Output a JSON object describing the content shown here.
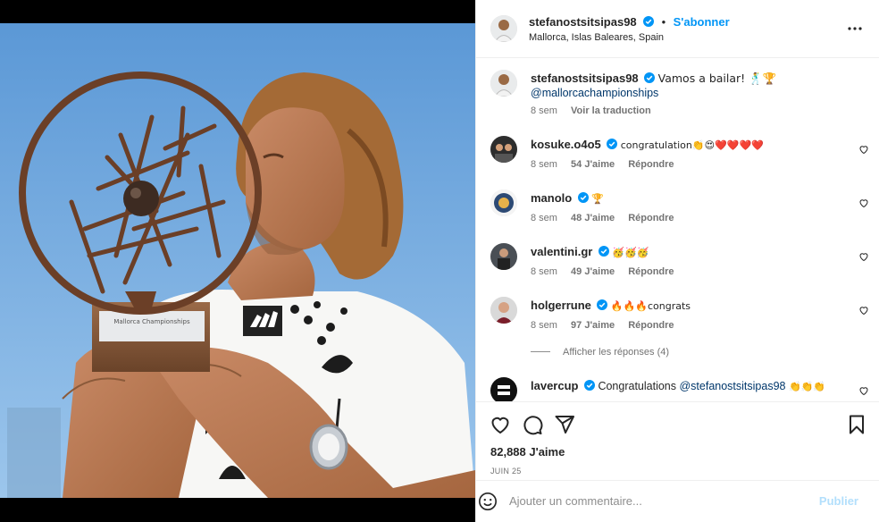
{
  "post": {
    "username": "stefanostsitsipas98",
    "follow_label": "S'abonner",
    "separator": "•",
    "location": "Mallorca, Islas Baleares, Spain",
    "caption_text": "Vamos a bailar! 🕺🏆",
    "caption_mention": "@mallorcachampionships",
    "caption_age": "8 sem",
    "translate_label": "Voir la traduction",
    "likes": "82,888 J'aime",
    "date": "JUIN 25"
  },
  "photo": {
    "trophy_plaque_text": "Mallorca Championships"
  },
  "comments": [
    {
      "user": "kosuke.o4o5",
      "text": "congratulation👏😍❤️❤️❤️❤️",
      "age": "8 sem",
      "likes": "54 J'aime",
      "reply": "Répondre"
    },
    {
      "user": "manolo",
      "text": "🏆",
      "age": "8 sem",
      "likes": "48 J'aime",
      "reply": "Répondre"
    },
    {
      "user": "valentini.gr",
      "text": "🥳🥳🥳",
      "age": "8 sem",
      "likes": "49 J'aime",
      "reply": "Répondre"
    },
    {
      "user": "holgerrune",
      "text": "🔥🔥🔥congrats",
      "age": "8 sem",
      "likes": "97 J'aime",
      "reply": "Répondre"
    },
    {
      "user": "lavercup",
      "text_prefix": "Congratulations ",
      "mention": "@stefanostsitsipas98",
      "text_suffix": " 👏👏👏"
    }
  ],
  "show_replies": "Afficher les réponses (4)",
  "composer": {
    "placeholder": "Ajouter un commentaire...",
    "publish_label": "Publier"
  },
  "icons": {
    "verified": "verified-badge-icon",
    "more": "more-options-icon",
    "like": "heart-icon",
    "comment": "comment-icon",
    "share": "paper-plane-icon",
    "save": "bookmark-icon",
    "emoji": "smiley-icon"
  },
  "colors": {
    "accent": "#0095f6",
    "verified": "#0095f6",
    "mention": "#00376b",
    "publish_disabled": "#b2dffc"
  }
}
